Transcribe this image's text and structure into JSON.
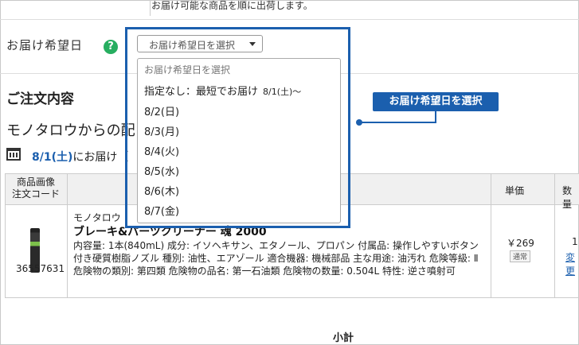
{
  "top_note": "お届け可能な商品を順に出荷します。",
  "delivery": {
    "label": "お届け希望日",
    "help_icon": "?",
    "select_value": "お届け希望日を選択"
  },
  "order": {
    "section_title": "ご注文内容",
    "from_line": "モノタロウからの配",
    "date_highlight": "8/1(土)",
    "date_suffix": "にお届け（"
  },
  "table": {
    "headers": {
      "image": "商品画像",
      "code": "注文コード",
      "price": "単価",
      "qty": "数量"
    },
    "row": {
      "code": "36557631",
      "maker": "モノタロウ",
      "name": "ブレーキ&パーツクリーナー 魂 2000",
      "desc": "内容量: 1本(840mL) 成分: イソヘキサン、エタノール、プロパン 付属品: 操作しやすいボタン付き硬質樹脂ノズル 種別: 油性、エアゾール 適合機器: 機械部品 主な用途: 油汚れ 危険等級: Ⅱ 危険物の類別: 第四類 危険物の品名: 第一石油類 危険物の数量: 0.504L 特性: 逆さ噴射可",
      "price": "￥269",
      "badge": "通常",
      "qty": "1",
      "change": "変更"
    }
  },
  "subtotal": "小計",
  "dropdown": {
    "options": [
      {
        "label": "お届け希望日を選択"
      },
      {
        "label": "指定なし：最短でお届け",
        "sub": "8/1(土)〜"
      },
      {
        "label": "8/2(日)"
      },
      {
        "label": "8/3(月)"
      },
      {
        "label": "8/4(火)"
      },
      {
        "label": "8/5(水)"
      },
      {
        "label": "8/6(木)"
      },
      {
        "label": "8/7(金)"
      }
    ]
  },
  "callout": "お届け希望日を選択",
  "colors": {
    "accent": "#1b5fae",
    "help": "#27ae60"
  }
}
